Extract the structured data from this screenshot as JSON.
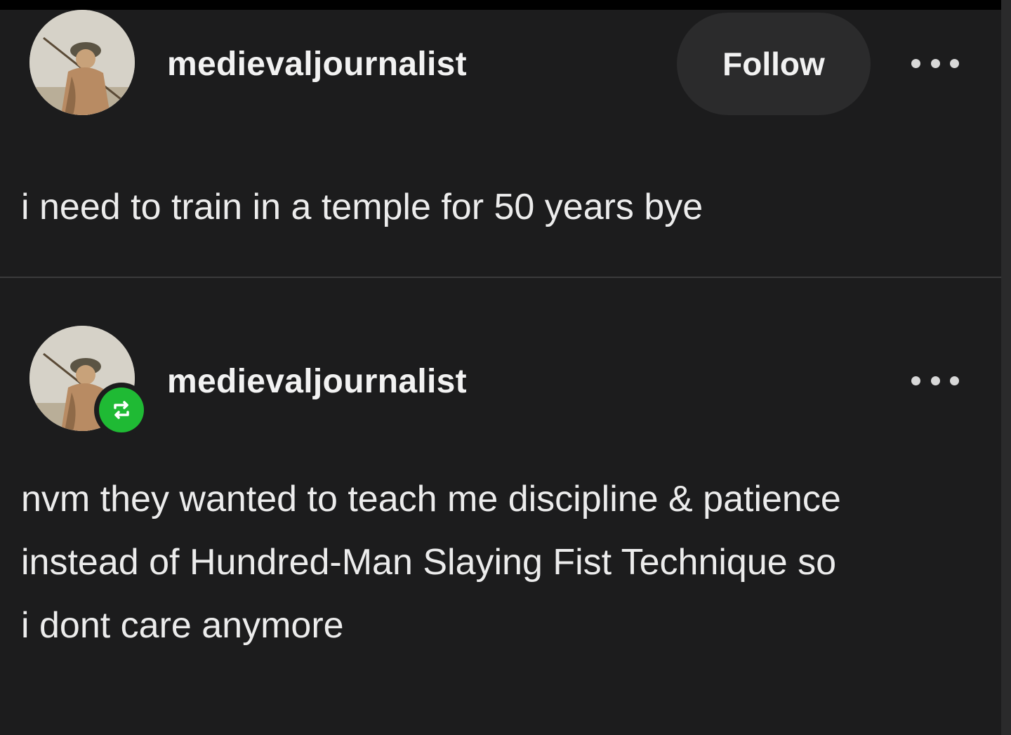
{
  "posts": [
    {
      "username": "medievaljournalist",
      "follow_label": "Follow",
      "more_icon": "ellipsis-icon",
      "text_lines": [
        "i need to train in a temple for 50 years bye"
      ]
    },
    {
      "username": "medievaljournalist",
      "more_icon": "ellipsis-icon",
      "reblog_icon": "reblog-icon",
      "text_lines": [
        "nvm they wanted to teach me discipline & patience",
        "instead of Hundred-Man Slaying Fist Technique so",
        "i dont care anymore"
      ]
    }
  ],
  "colors": {
    "background": "#1c1c1d",
    "text": "#ececec",
    "follow_button": "#2b2b2c",
    "reblog_badge": "#1fba34"
  }
}
